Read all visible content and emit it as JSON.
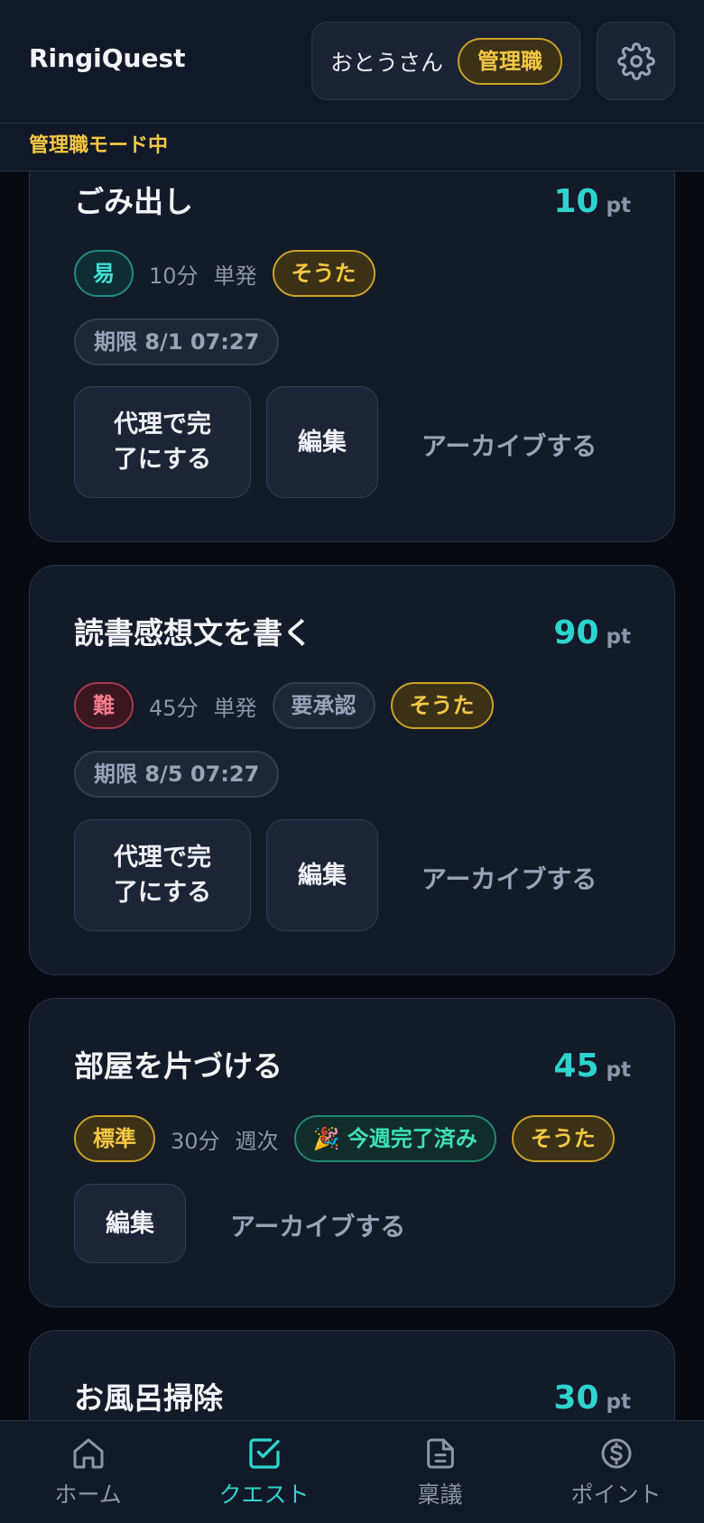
{
  "app": {
    "title": "RingiQuest"
  },
  "user": {
    "name": "おとうさん",
    "role": "管理職"
  },
  "mode_banner": "管理職モード中",
  "quests": [
    {
      "title": "ごみ出し",
      "points": "10",
      "points_unit": "pt",
      "difficulty": "易",
      "duration": "10分",
      "frequency": "単発",
      "assignee": "そうた",
      "deadline": "期限 8/1 07:27",
      "actions": {
        "complete": "代理で完了にする",
        "edit": "編集",
        "archive": "アーカイブする"
      }
    },
    {
      "title": "読書感想文を書く",
      "points": "90",
      "points_unit": "pt",
      "difficulty": "難",
      "duration": "45分",
      "frequency": "単発",
      "approval": "要承認",
      "assignee": "そうた",
      "deadline": "期限 8/5 07:27",
      "actions": {
        "complete": "代理で完了にする",
        "edit": "編集",
        "archive": "アーカイブする"
      }
    },
    {
      "title": "部屋を片づける",
      "points": "45",
      "points_unit": "pt",
      "difficulty": "標準",
      "duration": "30分",
      "frequency": "週次",
      "status": "🎉 今週完了済み",
      "assignee": "そうた",
      "actions": {
        "edit": "編集",
        "archive": "アーカイブする"
      }
    },
    {
      "title": "お風呂掃除",
      "points": "30",
      "points_unit": "pt"
    }
  ],
  "nav": {
    "items": [
      {
        "label": "ホーム",
        "icon": "home-icon"
      },
      {
        "label": "クエスト",
        "icon": "check-square-icon",
        "active": true
      },
      {
        "label": "稟議",
        "icon": "document-icon"
      },
      {
        "label": "ポイント",
        "icon": "coin-icon"
      }
    ]
  },
  "colors": {
    "accent": "#2dd4cf",
    "gold": "#f5c842",
    "background": "#070a11",
    "card": "#131a28"
  }
}
